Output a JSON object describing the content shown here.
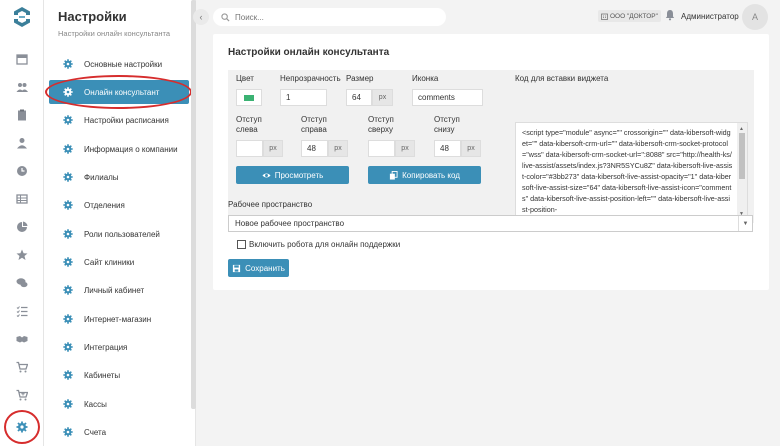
{
  "header": {
    "search_placeholder": "Поиск...",
    "org_label": "ООО \"ДОКТОР\"",
    "user_name": "Администратор",
    "avatar_letter": "A"
  },
  "menu": {
    "title": "Настройки",
    "subtitle": "Настройки онлайн консультанта",
    "items": [
      {
        "label": "Основные настройки"
      },
      {
        "label": "Онлайн консультант"
      },
      {
        "label": "Настройки расписания"
      },
      {
        "label": "Информация о компании"
      },
      {
        "label": "Филиалы"
      },
      {
        "label": "Отделения"
      },
      {
        "label": "Роли пользователей"
      },
      {
        "label": "Сайт клиники"
      },
      {
        "label": "Личный кабинет"
      },
      {
        "label": "Интернет-магазин"
      },
      {
        "label": "Интеграция"
      },
      {
        "label": "Кабинеты"
      },
      {
        "label": "Кассы"
      },
      {
        "label": "Счета"
      }
    ]
  },
  "card": {
    "title": "Настройки онлайн консультанта",
    "color_label": "Цвет",
    "color_value": "#3bb273",
    "opacity_label": "Непрозрачность",
    "opacity_value": "1",
    "size_label": "Размер",
    "size_value": "64",
    "size_unit": "px",
    "icon_label": "Иконка",
    "icon_value": "comments",
    "code_label": "Код для вставки виджета",
    "code_text": "<script type=\"module\" async=\"\" crossorigin=\"\" data-kibersoft-widget=\"\" data-kibersoft-crm-url=\"\" data-kibersoft-crm-socket-protocol=\"wss\" data-kibersoft-crm-socket-url=\":8088\" src=\"http://health-ks/live-assist/assets/index.js?3NR5SYCu8Z\" data-kibersoft-live-assist-color=\"#3bb273\" data-kibersoft-live-assist-opacity=\"1\" data-kibersoft-live-assist-size=\"64\" data-kibersoft-live-assist-icon=\"comments\" data-kibersoft-live-assist-position-left=\"\" data-kibersoft-live-assist-position-",
    "offset_left_label": "Отступ\nслева",
    "offset_left_value": "",
    "offset_right_label": "Отступ\nсправа",
    "offset_right_value": "48",
    "offset_top_label": "Отступ\nсверху",
    "offset_top_value": "",
    "offset_bottom_label": "Отступ\nснизу",
    "offset_bottom_value": "48",
    "unit": "px",
    "preview_button": "Просмотреть",
    "copy_button": "Копировать код",
    "workspace_label": "Рабочее пространство",
    "workspace_value": "Новое рабочее пространство",
    "robot_checkbox_label": "Включить робота для онлайн поддержки",
    "save_button": "Сохранить"
  },
  "colors": {
    "accent": "#3b8fb7",
    "highlight": "#d62d2d",
    "widget_color": "#3bb273"
  }
}
